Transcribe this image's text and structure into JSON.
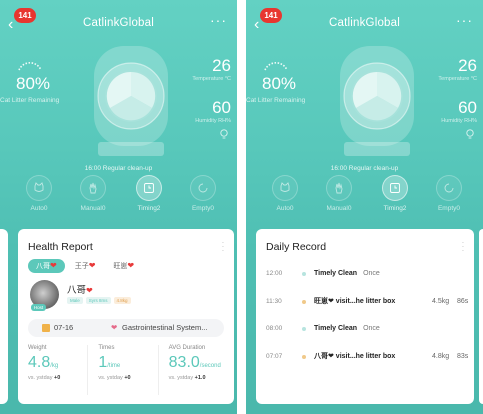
{
  "app": {
    "title": "CatlinkGlobal",
    "badge": "141",
    "more_icon": "more-dots-icon",
    "back_icon": "back-arrow-icon"
  },
  "device": {
    "litter_pct": "80%",
    "litter_label": "Cat Litter Remaining",
    "temperature": "26",
    "temperature_label": "Temperature °C",
    "humidity": "60",
    "humidity_label": "Humidity RH%",
    "clean_schedule": "16:00 Regular clean-up"
  },
  "modes": [
    {
      "label": "Auto0",
      "icon": "cat-icon",
      "active": false
    },
    {
      "label": "Manual0",
      "icon": "hand-icon",
      "active": false
    },
    {
      "label": "Timing2",
      "icon": "timer-icon",
      "active": true
    },
    {
      "label": "Empty0",
      "icon": "empty-icon",
      "active": false
    }
  ],
  "health": {
    "title": "Health Report",
    "pets": [
      "八哥",
      "王子",
      "旺崽"
    ],
    "selected_pet": "八哥",
    "pet_name": "八哥",
    "owner_tag": "Host",
    "tags": [
      "Male",
      "Syrs 8ms",
      "4.8kg"
    ],
    "alert_date": "07-16",
    "alert_text": "Gastrointestinal System...",
    "metrics": [
      {
        "label": "Weight",
        "value": "4.8",
        "unit": "/kg",
        "cmp_label": "vs. ystday",
        "cmp_value": "+0"
      },
      {
        "label": "Times",
        "value": "1",
        "unit": "/time",
        "cmp_label": "vs. ystday",
        "cmp_value": "+0"
      },
      {
        "label": "AVG Duration",
        "value": "83.0",
        "unit": "/second",
        "cmp_label": "vs. ystday",
        "cmp_value": "+1.0"
      }
    ]
  },
  "daily": {
    "title": "Daily Record",
    "records": [
      {
        "time": "12:00",
        "event": "Timely Clean",
        "sub": "Once",
        "kg": "",
        "sec": ""
      },
      {
        "time": "11:30",
        "event": "旺崽❤ visit...he litter box",
        "sub": "",
        "kg": "4.5kg",
        "sec": "86s"
      },
      {
        "time": "08:00",
        "event": "Timely Clean",
        "sub": "Once",
        "kg": "",
        "sec": ""
      },
      {
        "time": "07:07",
        "event": "八哥❤ visit...he litter box",
        "sub": "",
        "kg": "4.8kg",
        "sec": "83s"
      }
    ]
  },
  "colors": {
    "accent": "#5cc8ba",
    "badge": "#e8362f",
    "heart": "#e83a3a",
    "background_top": "#63d1c3",
    "background_bottom": "#4ab8ac"
  }
}
